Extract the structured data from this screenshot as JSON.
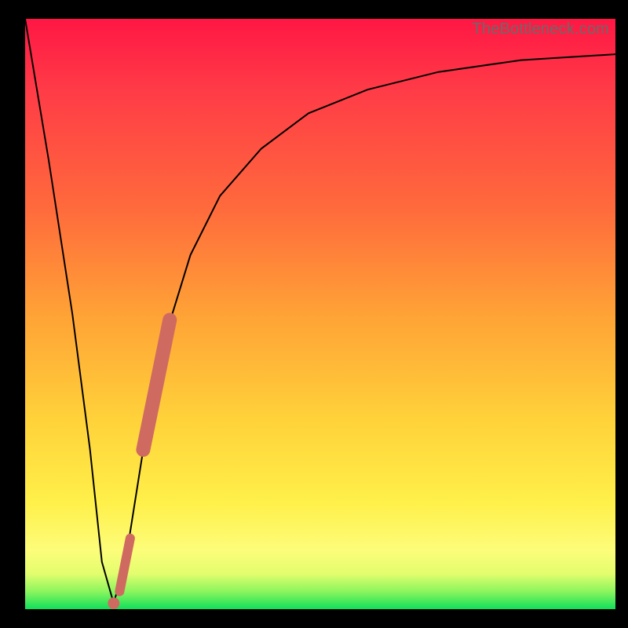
{
  "watermark": "TheBottleneck.com",
  "chart_data": {
    "type": "line",
    "title": "",
    "xlabel": "",
    "ylabel": "",
    "xlim": [
      0,
      100
    ],
    "ylim": [
      0,
      100
    ],
    "series": [
      {
        "name": "bottleneck-curve",
        "x": [
          0,
          4,
          8,
          11,
          13,
          15,
          17,
          20,
          24,
          28,
          33,
          40,
          48,
          58,
          70,
          84,
          100
        ],
        "y": [
          100,
          76,
          50,
          27,
          8,
          1,
          8,
          27,
          47,
          60,
          70,
          78,
          84,
          88,
          91,
          93,
          94
        ]
      }
    ],
    "markers": [
      {
        "name": "segment-a",
        "x1": 20.0,
        "y1": 27,
        "x2": 24.5,
        "y2": 49,
        "thickness": 2.4
      },
      {
        "name": "segment-b",
        "x1": 16.0,
        "y1": 3,
        "x2": 17.8,
        "y2": 12,
        "thickness": 1.6
      },
      {
        "name": "point-min",
        "x": 15.0,
        "y": 1.0,
        "r": 1.0
      }
    ],
    "colors": {
      "curve": "#000000",
      "marker": "#cf6a61",
      "gradient_top": "#ff1744",
      "gradient_bottom": "#10e05a"
    }
  }
}
